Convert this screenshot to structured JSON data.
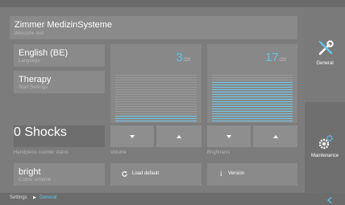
{
  "header": {
    "title": "Zimmer MedizinSysteme",
    "subtitle": "Welcome text"
  },
  "language": {
    "value": "English (BE)",
    "label": "Language"
  },
  "therapy": {
    "value": "Therapy",
    "label": "Start Settings"
  },
  "shocks": {
    "value": "0 Shocks",
    "label": "Handpiece counter status"
  },
  "colour": {
    "value": "bright",
    "label": "Colour scheme"
  },
  "volume": {
    "value": "3",
    "max": "/20",
    "label": "Volume",
    "level": 0.15
  },
  "brightness": {
    "value": "17",
    "max": "/20",
    "label": "Brightness",
    "level": 0.85
  },
  "actions": {
    "load_default": "Load default",
    "version": "Version",
    "info_glyph": "i"
  },
  "sidebar": {
    "general": "General",
    "maintenance": "Maintenance"
  },
  "breadcrumb": {
    "root": "Settings",
    "current": "General",
    "separator": "▶"
  },
  "colors": {
    "accent": "#64c3ea",
    "bar_off": "#9a9a9a",
    "bar_on": "#6fc8ea"
  },
  "icons": {
    "tools": "wrench-screwdriver-icon",
    "gears": "gears-icon",
    "reload": "reload-icon",
    "info": "info-icon",
    "chevron": "chevron-left-icon"
  }
}
